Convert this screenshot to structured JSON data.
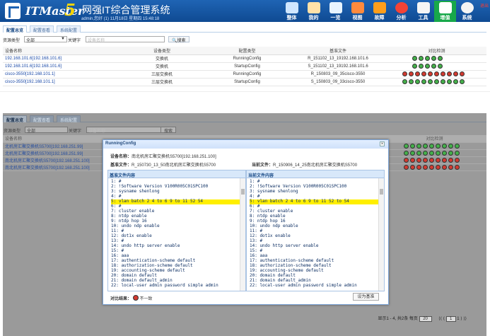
{
  "app": {
    "brand": "ITMaster",
    "brand_num": "5",
    "title": "网强IT综合管理系统",
    "user_line": "admin,您好 (1) 11月18日 星期四 15:48:18",
    "logout": "退出"
  },
  "nav": [
    {
      "label": "整体"
    },
    {
      "label": "我的"
    },
    {
      "label": "一览"
    },
    {
      "label": "视图"
    },
    {
      "label": "故障"
    },
    {
      "label": "分析"
    },
    {
      "label": "工具"
    },
    {
      "label": "增值"
    },
    {
      "label": "系统"
    }
  ],
  "tabs": [
    "配置总览",
    "配置查看",
    "系统配置"
  ],
  "filter": {
    "type_label": "资源类型",
    "type_value": "全部",
    "keyword_label": "关键字",
    "keyword_placeholder": "设备名称",
    "search": "搜索"
  },
  "table": {
    "headers": [
      "设备名称",
      "设备类型",
      "配置类型",
      "基准文件",
      "对比检测"
    ],
    "rows": [
      {
        "name": "192.168.101.6[192.168.101.6]",
        "type": "交换机",
        "config": "RunningConfig",
        "base": "R_151102_13_19192.168.101.6",
        "dots": [
          "g",
          "g",
          "g",
          "g",
          "g"
        ]
      },
      {
        "name": "192.168.101.6[192.168.101.6]",
        "type": "交换机",
        "config": "StartupConfig",
        "base": "S_151102_13_19192.168.101.6",
        "dots": [
          "g",
          "g",
          "g",
          "g",
          "g"
        ]
      },
      {
        "name": "cisco-3550[192.168.101.1]",
        "type": "三层交换机",
        "config": "RunningConfig",
        "base": "R_150803_09_35cisco-3550",
        "dots": [
          "r",
          "r",
          "r",
          "r",
          "r",
          "r",
          "r",
          "r",
          "r",
          "r"
        ]
      },
      {
        "name": "cisco-3550[192.168.101.1]",
        "type": "三层交换机",
        "config": "StartupConfig",
        "base": "S_150803_09_33cisco-3550",
        "dots": [
          "g",
          "g",
          "g",
          "g",
          "g",
          "g",
          "g",
          "g",
          "g",
          "g"
        ]
      }
    ]
  },
  "table2": {
    "rows": [
      {
        "name": "北机房汇聚交换机S5700[192.168.251.99]",
        "dots": "ggggggggg"
      },
      {
        "name": "北机房汇聚交换机S5700[192.168.251.99]",
        "dots": "ggggggggg"
      },
      {
        "name": "南北机房汇聚交换机S5700[192.168.251.100]",
        "dots": "rrrrrrrrr"
      },
      {
        "name": "南北机房汇聚交换机S5700[192.168.251.100]",
        "dots": "rrrrrrrrr"
      }
    ]
  },
  "dialog": {
    "title": "RunningConfig",
    "device_label": "设备名称：",
    "device": "南北机房汇聚交换机S5700[192.168.251.100]",
    "base_label": "基准文件：",
    "base": "R_150730_13_50南北机房汇聚交换机S5700",
    "current_label": "当前文件：",
    "current": "R_150906_14_25南北机房汇聚交换机S5700",
    "left_head": "基准文件内容",
    "right_head": "当前文件内容",
    "result_label": "对比结果：",
    "result": "不一致",
    "close": "设为基准"
  },
  "left_code": [
    "1: #",
    "2: !Software Version V100R005C01SPC100",
    "3: sysname shenlong",
    "4: #",
    "5: vlan batch 2 4 to 6 9 to 11 52 54",
    "6: #",
    "7: cluster enable",
    "8: ntdp enable",
    "9: ntdp hop 16",
    "10: undo ndp enable",
    "11: #",
    "12: dot1x enable",
    "13: #",
    "14: undo http server enable",
    "15: #",
    "16: aaa",
    "17: authentication-scheme default",
    "18: authorization-scheme default",
    "19: accounting-scheme default",
    "20: domain default",
    "21: domain default_admin",
    "22: local-user admin password simple admin"
  ],
  "right_code": [
    "1: #",
    "2: !Software Version V100R005C01SPC100",
    "3: sysname shenlong",
    "4: #",
    "5: vlan batch 2 4 to 6 9 to 11 52 to 54",
    "6: #",
    "7: cluster enable",
    "8: ntdp enable",
    "9: ntdp hop 16",
    "10: undo ndp enable",
    "11: #",
    "12: dot1x enable",
    "13: #",
    "14: undo http server enable",
    "15: #",
    "16: aaa",
    "17: authentication-scheme default",
    "18: authorization-scheme default",
    "19: accounting-scheme default",
    "20: domain default",
    "21: domain default_admin",
    "22: local-user admin password simple admin"
  ],
  "pager": {
    "text": "显示1 - 4, 共2条 每页",
    "size": "20",
    "page": "1",
    "of": "1"
  }
}
